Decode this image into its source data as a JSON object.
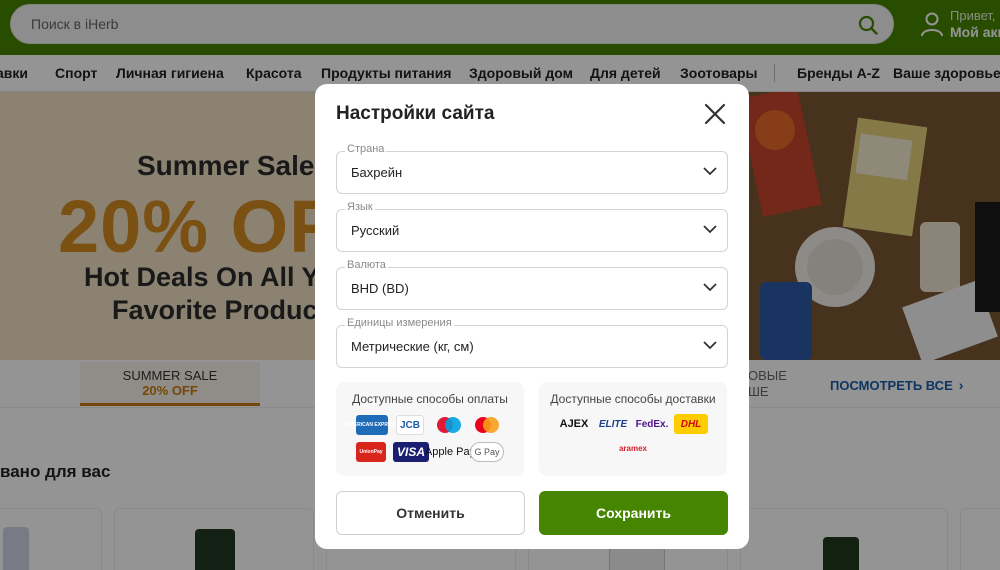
{
  "header": {
    "search_placeholder": "Поиск в iHerb",
    "greeting": "Привет,",
    "account_label": "Мой акк"
  },
  "nav": {
    "items": [
      "авки",
      "Спорт",
      "Личная гигиена",
      "Красота",
      "Продукты питания",
      "Здоровый дом",
      "Для детей",
      "Зоотовары",
      "Бренды A-Z",
      "Ваше здоровье"
    ]
  },
  "hero": {
    "title": "Summer Sale",
    "discount": "20% OF",
    "line1": "Hot Deals On All Yo",
    "line2": "Favorite Products"
  },
  "promo": {
    "tab_title": "SUMMER SALE",
    "tab_subtitle": "20% OFF",
    "partial_line1": "ОВЫЕ",
    "partial_line2": "ШЕ",
    "see_all": "ПОСМОТРЕТЬ ВСЕ"
  },
  "section": {
    "title": "вано для вас"
  },
  "modal": {
    "title": "Настройки сайта",
    "fields": [
      {
        "label": "Страна",
        "value": "Бахрейн"
      },
      {
        "label": "Язык",
        "value": "Русский"
      },
      {
        "label": "Валюта",
        "value": "BHD (BD)"
      },
      {
        "label": "Единицы измерения",
        "value": "Метрические (кг, см)"
      }
    ],
    "payment": {
      "title": "Доступные способы оплаты",
      "logos": [
        "AMERICAN EXPRESS",
        "JCB",
        "maestro",
        "mastercard",
        "UnionPay",
        "VISA",
        "Apple Pay",
        "G Pay"
      ]
    },
    "delivery": {
      "title": "Доступные способы доставки",
      "logos": [
        "AJEX",
        "ELITE",
        "FedEx.",
        "DHL",
        "aramex"
      ]
    },
    "cancel_label": "Отменить",
    "save_label": "Сохранить"
  },
  "colors": {
    "brand_green": "#458500",
    "sale_orange": "#d38a22",
    "link_blue": "#1a5ea8"
  }
}
